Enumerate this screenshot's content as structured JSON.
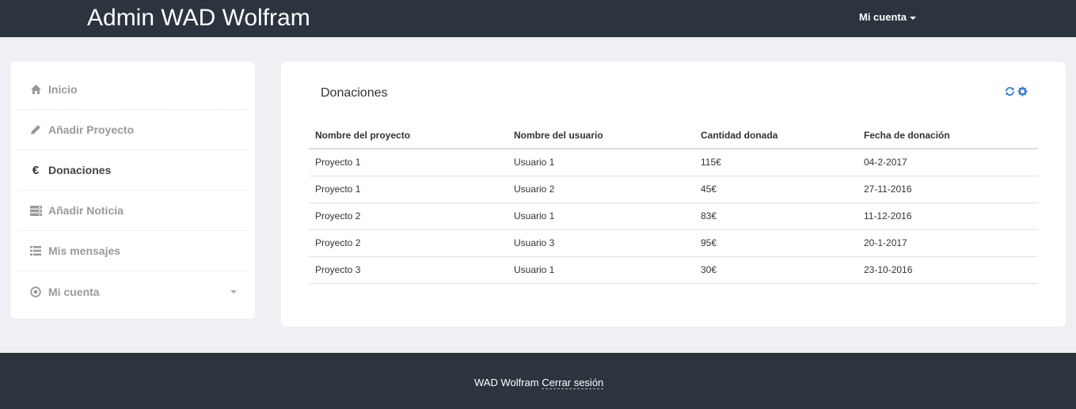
{
  "header": {
    "title": "Admin WAD Wolfram",
    "account_menu": "Mi cuenta"
  },
  "sidebar": {
    "items": [
      {
        "label": "Inicio",
        "icon": "home-icon"
      },
      {
        "label": "Añadir Proyecto",
        "icon": "pencil-icon"
      },
      {
        "label": "Donaciones",
        "icon": "euro-icon"
      },
      {
        "label": "Añadir Noticia",
        "icon": "server-icon"
      },
      {
        "label": "Mis mensajes",
        "icon": "list-icon"
      },
      {
        "label": "Mi cuenta",
        "icon": "record-icon"
      }
    ],
    "active": "Donaciones"
  },
  "panel": {
    "title": "Donaciones",
    "columns": [
      "Nombre del proyecto",
      "Nombre del usuario",
      "Cantidad donada",
      "Fecha de donación"
    ],
    "rows": [
      [
        "Proyecto 1",
        "Usuario 1",
        "115€",
        "04-2-2017"
      ],
      [
        "Proyecto 1",
        "Usuario 2",
        "45€",
        "27-11-2016"
      ],
      [
        "Proyecto 2",
        "Usuario 1",
        "83€",
        "11-12-2016"
      ],
      [
        "Proyecto 2",
        "Usuario 3",
        "95€",
        "20-1-2017"
      ],
      [
        "Proyecto 3",
        "Usuario 1",
        "30€",
        "23-10-2016"
      ]
    ]
  },
  "footer": {
    "brand": "WAD Wolfram",
    "logout": "Cerrar sesión"
  },
  "colors": {
    "dark": "#2c3440",
    "background": "#eef0f3",
    "accent": "#3a7bd5"
  }
}
